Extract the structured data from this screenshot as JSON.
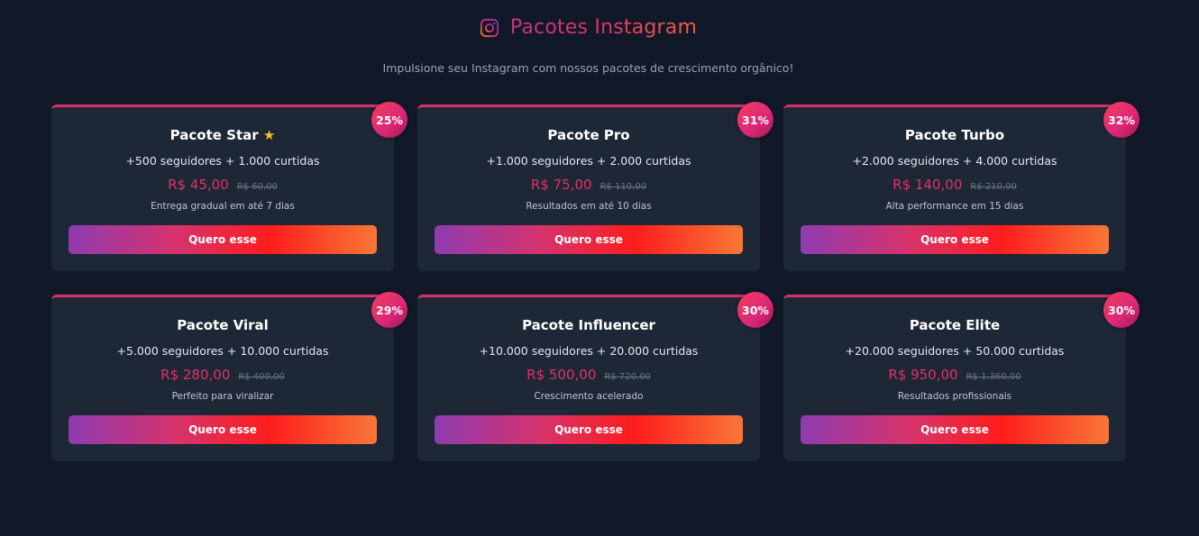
{
  "header": {
    "icon": "instagram-icon",
    "title": "Pacotes Instagram",
    "subtitle": "Impulsione seu Instagram com nossos pacotes de crescimento orgânico!"
  },
  "colors": {
    "background": "#111827",
    "card": "#1e2735",
    "accent": "#e1306c",
    "badge": "#db2777"
  },
  "packages": [
    {
      "name": "Pacote Star",
      "star": "★",
      "description": "+500 seguidores + 1.000 curtidas",
      "price": "R$ 45,00",
      "old_price": "R$ 60,00",
      "note": "Entrega gradual em até 7 dias",
      "discount": "25%",
      "button": "Quero esse"
    },
    {
      "name": "Pacote Pro",
      "description": "+1.000 seguidores + 2.000 curtidas",
      "price": "R$ 75,00",
      "old_price": "R$ 110,00",
      "note": "Resultados em até 10 dias",
      "discount": "31%",
      "button": "Quero esse"
    },
    {
      "name": "Pacote Turbo",
      "description": "+2.000 seguidores + 4.000 curtidas",
      "price": "R$ 140,00",
      "old_price": "R$ 210,00",
      "note": "Alta performance em 15 dias",
      "discount": "32%",
      "button": "Quero esse"
    },
    {
      "name": "Pacote Viral",
      "description": "+5.000 seguidores + 10.000 curtidas",
      "price": "R$ 280,00",
      "old_price": "R$ 400,00",
      "note": "Perfeito para viralizar",
      "discount": "29%",
      "button": "Quero esse"
    },
    {
      "name": "Pacote Influencer",
      "description": "+10.000 seguidores + 20.000 curtidas",
      "price": "R$ 500,00",
      "old_price": "R$ 720,00",
      "note": "Crescimento acelerado",
      "discount": "30%",
      "button": "Quero esse"
    },
    {
      "name": "Pacote Elite",
      "description": "+20.000 seguidores + 50.000 curtidas",
      "price": "R$ 950,00",
      "old_price": "R$ 1.360,00",
      "note": "Resultados profissionais",
      "discount": "30%",
      "button": "Quero esse"
    }
  ]
}
